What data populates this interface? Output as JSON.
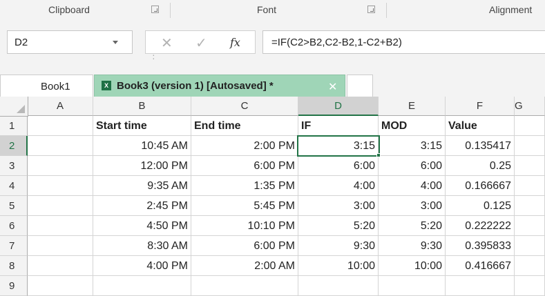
{
  "ribbon": {
    "groups": [
      "Clipboard",
      "Font",
      "Alignment"
    ]
  },
  "namebox": {
    "value": "D2"
  },
  "formula": {
    "value": "=IF(C2>B2,C2-B2,1-C2+B2)"
  },
  "tabs": [
    {
      "label": "Book1"
    },
    {
      "label": "Book3 (version 1) [Autosaved] *"
    }
  ],
  "icons": {
    "excel_icon": "excel-file-icon",
    "cancel": "✕",
    "enter": "✓",
    "fx": "fx",
    "close": "✕"
  },
  "columns": [
    "A",
    "B",
    "C",
    "D",
    "E",
    "F",
    "G"
  ],
  "rows": [
    {
      "n": "1",
      "cells": [
        "",
        "Start time",
        "End time",
        "IF",
        "MOD",
        "Value"
      ]
    },
    {
      "n": "2",
      "cells": [
        "",
        "10:45 AM",
        "2:00 PM",
        "3:15",
        "3:15",
        "0.135417"
      ]
    },
    {
      "n": "3",
      "cells": [
        "",
        "12:00 PM",
        "6:00 PM",
        "6:00",
        "6:00",
        "0.25"
      ]
    },
    {
      "n": "4",
      "cells": [
        "",
        "9:35 AM",
        "1:35 PM",
        "4:00",
        "4:00",
        "0.166667"
      ]
    },
    {
      "n": "5",
      "cells": [
        "",
        "2:45 PM",
        "5:45 PM",
        "3:00",
        "3:00",
        "0.125"
      ]
    },
    {
      "n": "6",
      "cells": [
        "",
        "4:50 PM",
        "10:10 PM",
        "5:20",
        "5:20",
        "0.222222"
      ]
    },
    {
      "n": "7",
      "cells": [
        "",
        "8:30 AM",
        "6:00 PM",
        "9:30",
        "9:30",
        "0.395833"
      ]
    },
    {
      "n": "8",
      "cells": [
        "",
        "4:00 PM",
        "2:00 AM",
        "10:00",
        "10:00",
        "0.416667"
      ]
    },
    {
      "n": "9",
      "cells": [
        "",
        "",
        "",
        "",
        "",
        ""
      ]
    }
  ],
  "active_cell": {
    "column": "D",
    "row": "2"
  },
  "colors": {
    "accent": "#217346",
    "active_tab": "#9fd5b7"
  }
}
